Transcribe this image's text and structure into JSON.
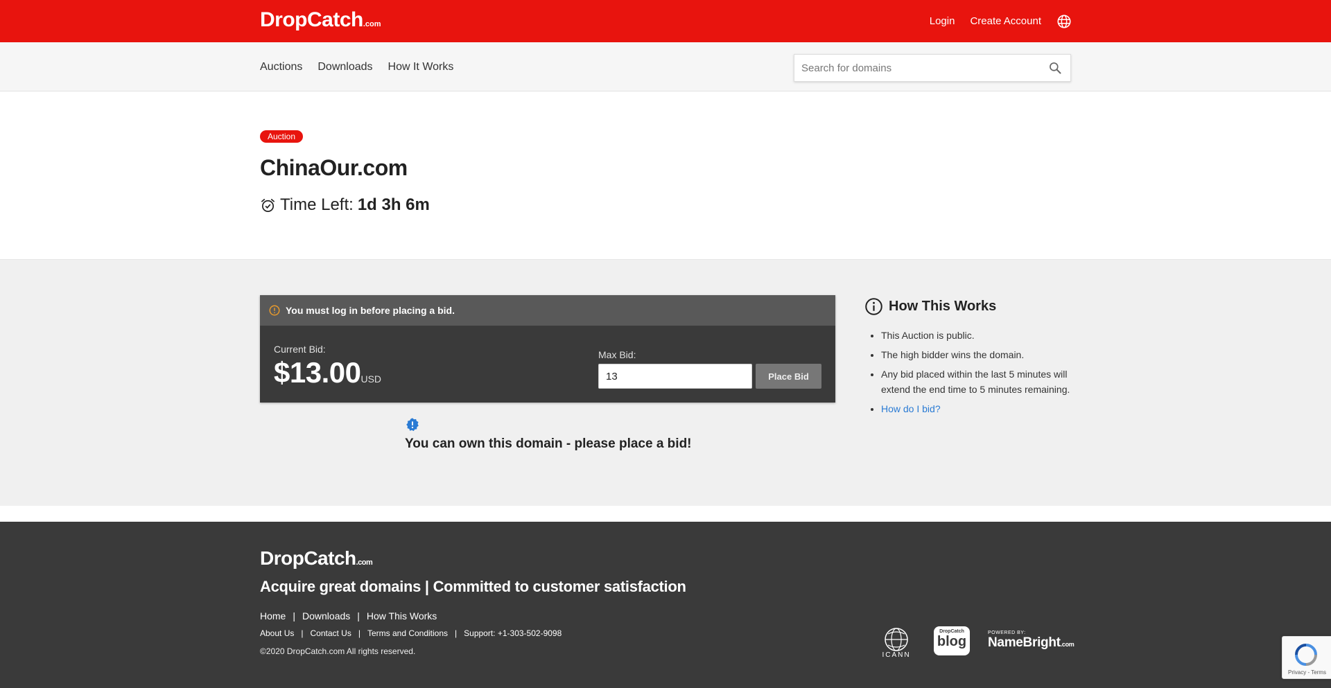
{
  "brand": {
    "name": "DropCatch",
    "suffix": ".com",
    "primary_color": "#e8140e"
  },
  "topnav": {
    "login": "Login",
    "create_account": "Create Account",
    "language_icon": "globe-icon"
  },
  "subnav": {
    "links": [
      "Auctions",
      "Downloads",
      "How It Works"
    ],
    "search_placeholder": "Search for domains"
  },
  "auction": {
    "badge": "Auction",
    "domain": "ChinaOur.com",
    "time_left_label": "Time Left:",
    "time_left_value": "1d 3h 6m"
  },
  "bid_panel": {
    "alert": "You must log in before placing a bid.",
    "current_bid_label": "Current Bid:",
    "current_bid_value": "$13.00",
    "currency": "USD",
    "max_bid_label": "Max Bid:",
    "max_bid_value": "13",
    "place_bid_button": "Place Bid",
    "own_message": "You can own this domain - please place a bid!"
  },
  "how_it_works": {
    "title": "How This Works",
    "items": [
      "This Auction is public.",
      "The high bidder wins the domain.",
      "Any bid placed within the last 5 minutes will extend the end time to 5 minutes remaining."
    ],
    "link": "How do I bid?"
  },
  "footer": {
    "tagline": "Acquire great domains | Committed to customer satisfaction",
    "links_primary": [
      "Home",
      "Downloads",
      "How This Works"
    ],
    "links_secondary": [
      "About Us",
      "Contact Us",
      "Terms and Conditions",
      "Support: +1-303-502-9098"
    ],
    "copyright": "©2020 DropCatch.com All rights reserved.",
    "partners": {
      "icann": "ICANN",
      "blog_small": "DropCatch",
      "blog_big": "blog",
      "powered_by": "POWERED BY:",
      "namebright": "NameBright",
      "namebright_suffix": ".com"
    }
  },
  "recaptcha": {
    "text": "Privacy - Terms"
  }
}
